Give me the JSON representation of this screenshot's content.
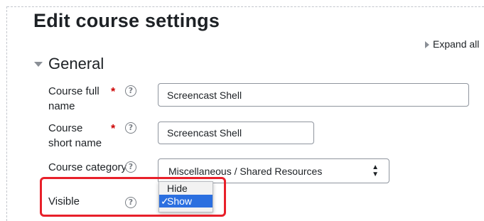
{
  "page": {
    "title": "Edit course settings",
    "expand_all": "Expand all"
  },
  "section": {
    "title": "General"
  },
  "fields": {
    "full_name": {
      "label": "Course full name",
      "value": "Screencast Shell"
    },
    "short_name": {
      "label": "Course short name",
      "value": "Screencast Shell"
    },
    "category": {
      "label": "Course category",
      "selected": "Miscellaneous / Shared Resources"
    },
    "visible": {
      "label": "Visible",
      "options": [
        "Hide",
        "Show"
      ],
      "selected": "Show",
      "check": "✓"
    }
  },
  "icons": {
    "required": "*",
    "help": "?",
    "select_arrows": [
      "▲",
      "▼"
    ]
  },
  "colors": {
    "accent_selected": "#2b6fe0",
    "required": "#cc0000",
    "highlight": "#e8202a"
  }
}
